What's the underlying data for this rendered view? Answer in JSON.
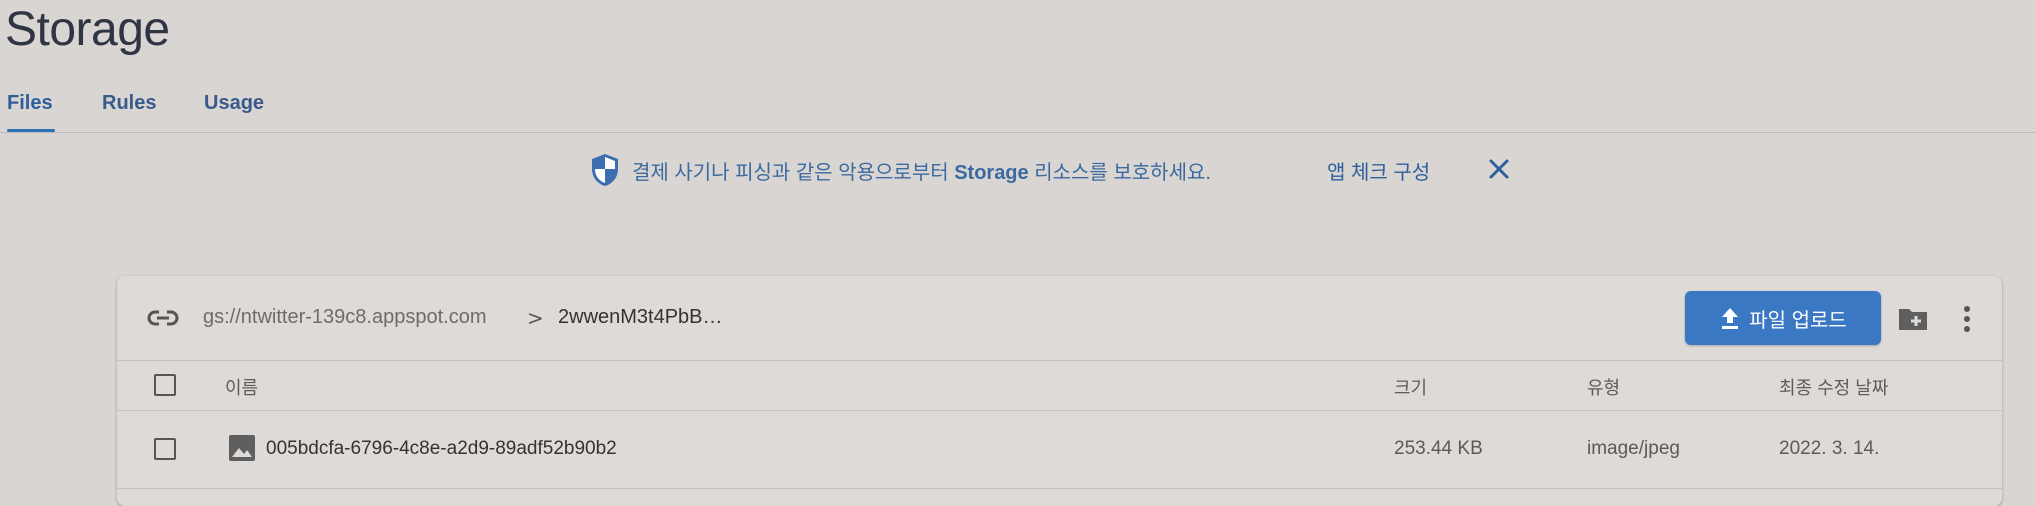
{
  "page": {
    "title": "Storage"
  },
  "tabs": [
    {
      "label": "Files",
      "active": true
    },
    {
      "label": "Rules",
      "active": false
    },
    {
      "label": "Usage",
      "active": false
    }
  ],
  "banner": {
    "text_before": "결제 사기나 피싱과 같은 악용으로부터 ",
    "text_bold": "Storage",
    "text_after": " 리소스를 보호하세요.",
    "link_label": "앱 체크 구성",
    "icons": {
      "shield": "shield-icon",
      "close": "close-icon"
    }
  },
  "browser": {
    "bucket": "gs://ntwitter-139c8.appspot.com",
    "separator": ">",
    "folder": "2wwenM3t4PbB…",
    "upload_label": "파일 업로드",
    "icons": {
      "link": "link-icon",
      "upload": "upload-icon",
      "new_folder": "new-folder-icon",
      "more": "more-vert-icon"
    }
  },
  "table": {
    "columns": [
      "이름",
      "크기",
      "유형",
      "최종 수정 날짜"
    ],
    "rows": [
      {
        "name": "005bdcfa-6796-4c8e-a2d9-89adf52b90b2",
        "size": "253.44 KB",
        "type": "image/jpeg",
        "modified": "2022. 3. 14.",
        "icon": "image-icon"
      }
    ]
  },
  "colors": {
    "accent": "#3b78c4",
    "background": "#d9d5d2",
    "link": "#2f5f9e"
  }
}
